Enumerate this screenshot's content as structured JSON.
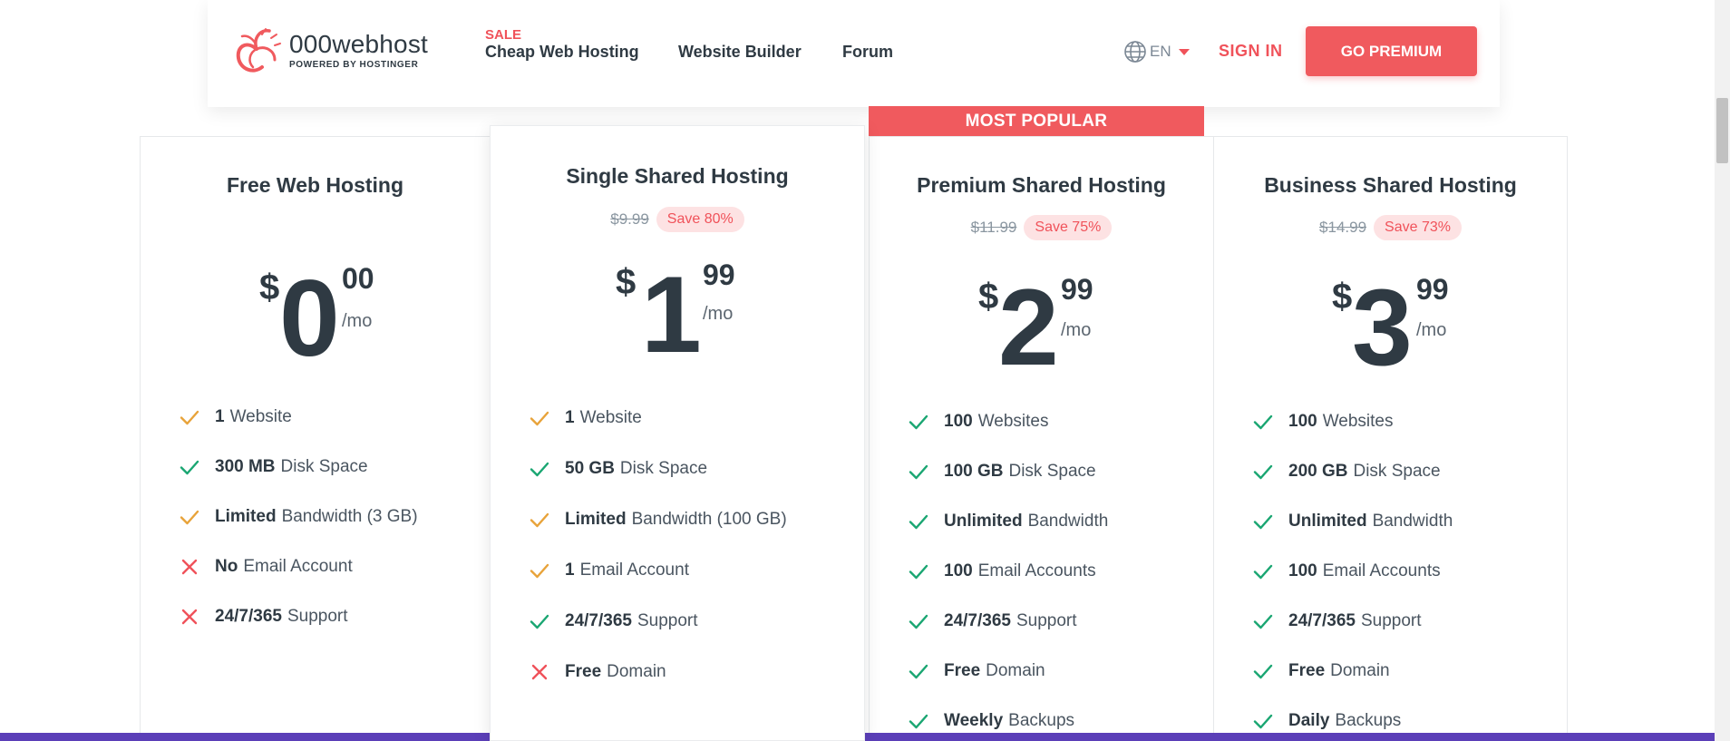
{
  "header": {
    "logo_name": "000webhost",
    "logo_sub": "POWERED BY HOSTINGER",
    "sale_tag": "SALE",
    "nav": [
      "Cheap Web Hosting",
      "Website Builder",
      "Forum"
    ],
    "lang": "EN",
    "signin": "SIGN IN",
    "premium": "GO PREMIUM"
  },
  "badge": "MOST POPULAR",
  "plans": [
    {
      "title": "Free Web Hosting",
      "currency": "$",
      "dollars": "0",
      "cents": "00",
      "period": "/mo",
      "features": [
        {
          "strong": "1",
          "text": "Website",
          "status": "partial"
        },
        {
          "strong": "300 MB",
          "text": "Disk Space",
          "status": "yes"
        },
        {
          "strong": "Limited",
          "text": "Bandwidth (3 GB)",
          "status": "partial"
        },
        {
          "strong": "No",
          "text": "Email Account",
          "status": "no"
        },
        {
          "strong": "24/7/365",
          "text": "Support",
          "status": "no"
        }
      ]
    },
    {
      "title": "Single Shared Hosting",
      "old_price": "$9.99",
      "save": "Save 80%",
      "currency": "$",
      "dollars": "1",
      "cents": "99",
      "period": "/mo",
      "features": [
        {
          "strong": "1",
          "text": "Website",
          "status": "partial"
        },
        {
          "strong": "50 GB",
          "text": "Disk Space",
          "status": "yes"
        },
        {
          "strong": "Limited",
          "text": "Bandwidth (100 GB)",
          "status": "partial"
        },
        {
          "strong": "1",
          "text": "Email Account",
          "status": "partial"
        },
        {
          "strong": "24/7/365",
          "text": "Support",
          "status": "yes"
        },
        {
          "strong": "Free",
          "text": "Domain",
          "status": "no"
        }
      ]
    },
    {
      "title": "Premium Shared Hosting",
      "old_price": "$11.99",
      "save": "Save 75%",
      "currency": "$",
      "dollars": "2",
      "cents": "99",
      "period": "/mo",
      "features": [
        {
          "strong": "100",
          "text": "Websites",
          "status": "yes"
        },
        {
          "strong": "100 GB",
          "text": "Disk Space",
          "status": "yes"
        },
        {
          "strong": "Unlimited",
          "text": "Bandwidth",
          "status": "yes"
        },
        {
          "strong": "100",
          "text": "Email Accounts",
          "status": "yes"
        },
        {
          "strong": "24/7/365",
          "text": "Support",
          "status": "yes"
        },
        {
          "strong": "Free",
          "text": "Domain",
          "status": "yes"
        },
        {
          "strong": "Weekly",
          "text": "Backups",
          "status": "yes"
        }
      ]
    },
    {
      "title": "Business Shared Hosting",
      "old_price": "$14.99",
      "save": "Save 73%",
      "currency": "$",
      "dollars": "3",
      "cents": "99",
      "period": "/mo",
      "features": [
        {
          "strong": "100",
          "text": "Websites",
          "status": "yes"
        },
        {
          "strong": "200 GB",
          "text": "Disk Space",
          "status": "yes"
        },
        {
          "strong": "Unlimited",
          "text": "Bandwidth",
          "status": "yes"
        },
        {
          "strong": "100",
          "text": "Email Accounts",
          "status": "yes"
        },
        {
          "strong": "24/7/365",
          "text": "Support",
          "status": "yes"
        },
        {
          "strong": "Free",
          "text": "Domain",
          "status": "yes"
        },
        {
          "strong": "Daily",
          "text": "Backups",
          "status": "yes"
        }
      ]
    }
  ],
  "colors": {
    "accent": "#f05a5e",
    "check_green": "#1aa672",
    "check_orange": "#e8a33a",
    "cross_red": "#f0525a",
    "text_dark": "#2f3a43",
    "bottom_strip": "#5b3fb8"
  }
}
